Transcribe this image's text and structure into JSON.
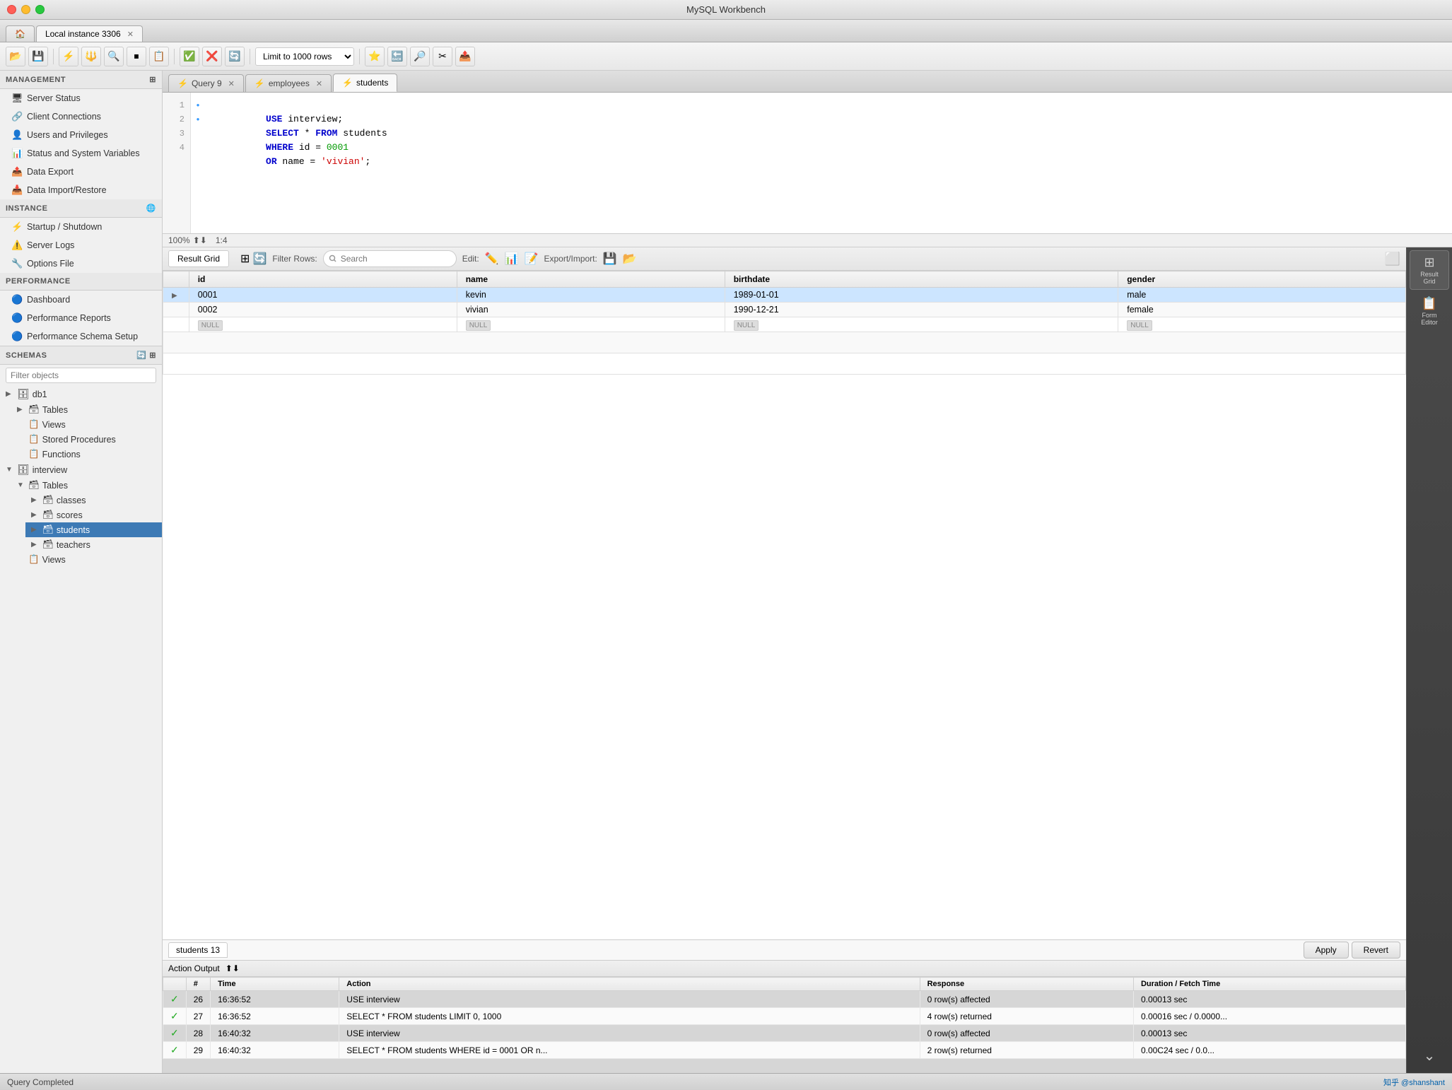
{
  "app": {
    "title": "MySQL Workbench",
    "window_tab": "Local instance 3306"
  },
  "toolbar": {
    "limit_label": "Limit to 1000 rows"
  },
  "sidebar": {
    "management_header": "MANAGEMENT",
    "instance_header": "INSTANCE",
    "performance_header": "PERFORMANCE",
    "schemas_header": "SCHEMAS",
    "management_items": [
      {
        "label": "Server Status",
        "icon": "🖥"
      },
      {
        "label": "Client Connections",
        "icon": "🔗"
      },
      {
        "label": "Users and Privileges",
        "icon": "👥"
      },
      {
        "label": "Status and System Variables",
        "icon": "📊"
      },
      {
        "label": "Data Export",
        "icon": "📤"
      },
      {
        "label": "Data Import/Restore",
        "icon": "📥"
      }
    ],
    "instance_items": [
      {
        "label": "Startup / Shutdown",
        "icon": "⚡"
      },
      {
        "label": "Server Logs",
        "icon": "⚠"
      },
      {
        "label": "Options File",
        "icon": "🔧"
      }
    ],
    "performance_items": [
      {
        "label": "Dashboard",
        "icon": "🔵"
      },
      {
        "label": "Performance Reports",
        "icon": "🔵"
      },
      {
        "label": "Performance Schema Setup",
        "icon": "🔵"
      }
    ],
    "schemas_filter_placeholder": "Filter objects",
    "schemas": [
      {
        "name": "db1",
        "children": [
          {
            "name": "Tables",
            "children": []
          },
          {
            "name": "Views",
            "children": []
          },
          {
            "name": "Stored Procedures",
            "children": []
          },
          {
            "name": "Functions",
            "children": []
          }
        ]
      },
      {
        "name": "interview",
        "expanded": true,
        "children": [
          {
            "name": "Tables",
            "expanded": true,
            "children": [
              {
                "name": "classes"
              },
              {
                "name": "scores"
              },
              {
                "name": "students",
                "active": true
              },
              {
                "name": "teachers"
              }
            ]
          },
          {
            "name": "Views",
            "children": []
          }
        ]
      }
    ]
  },
  "query_tabs": [
    {
      "label": "Query 9",
      "icon": "⚡",
      "closable": true
    },
    {
      "label": "employees",
      "icon": "⚡",
      "closable": true
    },
    {
      "label": "students",
      "icon": "⚡",
      "closable": false,
      "active": true
    }
  ],
  "sql_editor": {
    "lines": [
      {
        "num": 1,
        "active": true,
        "text": "USE interview;"
      },
      {
        "num": 2,
        "active": true,
        "text": "SELECT * FROM students"
      },
      {
        "num": 3,
        "active": false,
        "text": "WHERE id = 0001"
      },
      {
        "num": 4,
        "active": false,
        "text": "OR name = 'vivian';"
      }
    ],
    "zoom": "100%",
    "position": "1:4"
  },
  "result_grid": {
    "tab_label": "Result Grid",
    "filter_label": "Filter Rows:",
    "filter_placeholder": "Search",
    "edit_label": "Edit:",
    "export_label": "Export/Import:",
    "columns": [
      "id",
      "name",
      "birthdate",
      "gender"
    ],
    "rows": [
      {
        "id": "0001",
        "name": "kevin",
        "birthdate": "1989-01-01",
        "gender": "male",
        "selected": true
      },
      {
        "id": "0002",
        "name": "vivian",
        "birthdate": "1990-12-21",
        "gender": "female",
        "selected": false
      },
      {
        "id": "NULL",
        "name": "NULL",
        "birthdate": "NULL",
        "gender": "NULL",
        "selected": false,
        "is_null": true
      }
    ]
  },
  "result_tabs": [
    {
      "label": "students 13"
    }
  ],
  "action_output": {
    "header": "Action Output",
    "columns": [
      "",
      "Time",
      "Action",
      "Response",
      "Duration / Fetch Time"
    ],
    "rows": [
      {
        "num": 26,
        "time": "16:36:52",
        "action": "USE interview",
        "response": "0 row(s) affected",
        "duration": "0.00013 sec"
      },
      {
        "num": 27,
        "time": "16:36:52",
        "action": "SELECT * FROM students LIMIT 0, 1000",
        "response": "4 row(s) returned",
        "duration": "0.00016 sec / 0.0000..."
      },
      {
        "num": 28,
        "time": "16:40:32",
        "action": "USE interview",
        "response": "0 row(s) affected",
        "duration": "0.00013 sec"
      },
      {
        "num": 29,
        "time": "16:40:32",
        "action": "SELECT * FROM students WHERE id = 0001  OR n...",
        "response": "2 row(s) returned",
        "duration": "0.00C24 sec / 0.0..."
      }
    ]
  },
  "buttons": {
    "apply": "Apply",
    "revert": "Revert"
  },
  "statusbar": {
    "left": "Query Completed",
    "right": "知乎 @shanshant"
  },
  "right_panel": {
    "result_grid_label": "Result\nGrid",
    "form_editor_label": "Form\nEditor"
  }
}
